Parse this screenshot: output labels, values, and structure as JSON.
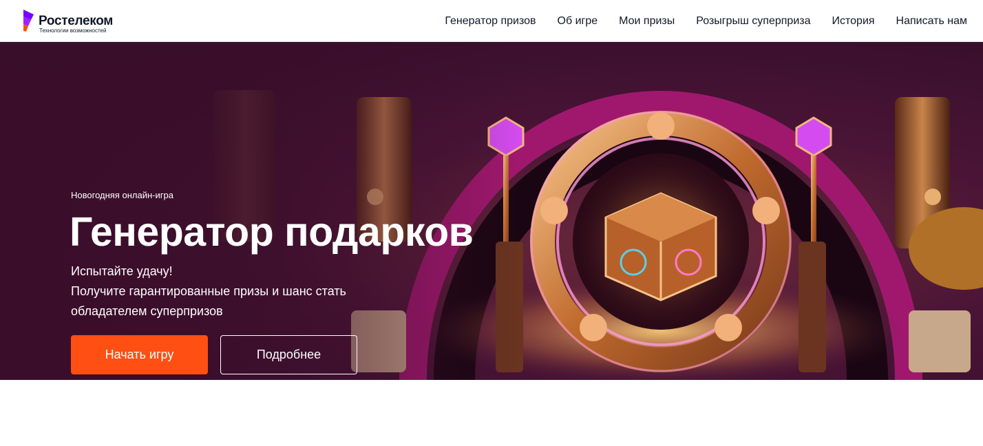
{
  "brand": {
    "name": "Ростелеком",
    "tagline": "Технологии возможностей",
    "colors": {
      "purple": "#7700ff",
      "orange": "#ff4f12"
    }
  },
  "nav": {
    "items": [
      {
        "label": "Генератор призов"
      },
      {
        "label": "Об игре"
      },
      {
        "label": "Мои призы"
      },
      {
        "label": "Розыгрыш суперприза"
      },
      {
        "label": "История"
      },
      {
        "label": "Написать нам"
      }
    ]
  },
  "hero": {
    "eyebrow": "Новогодняя онлайн-игра",
    "title": "Генератор подарков",
    "subtitle_lines": [
      "Испытайте удачу!",
      "Получите гарантированные призы и шанс стать",
      "обладателем суперпризов"
    ],
    "primary_button": "Начать игру",
    "secondary_button": "Подробнее",
    "colors": {
      "background": "#3a0e2a",
      "accent_button": "#ff4f12"
    }
  }
}
